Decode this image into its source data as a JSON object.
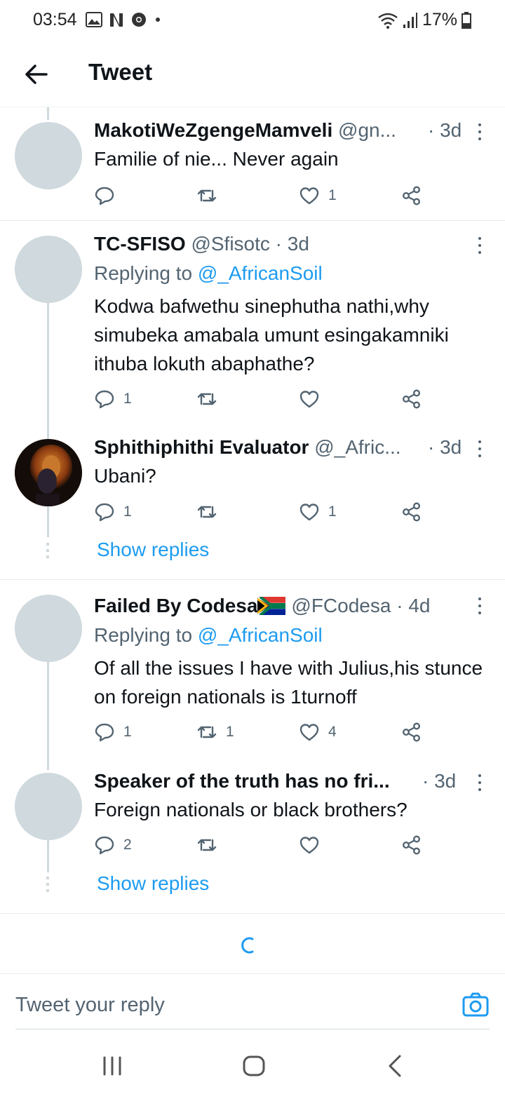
{
  "status_bar": {
    "time": "03:54",
    "battery": "17%"
  },
  "header": {
    "title": "Tweet"
  },
  "tweets": [
    {
      "name": "MakotiWeZgengeMamveli",
      "handle": "@gn...",
      "time": "· 3d",
      "replying_label": "",
      "replying_handle": "",
      "text": "Familie of nie... Never again",
      "replies": "",
      "retweets": "",
      "likes": "1"
    },
    {
      "name": "TC-SFISO",
      "handle": "@Sfisotc · 3d",
      "time": "",
      "replying_label": "Replying to",
      "replying_handle": "@_AfricanSoil",
      "text": "Kodwa bafwethu sinephutha nathi,why simubeka amabala umunt esingakamniki ithuba lokuth abaphathe?",
      "replies": "1",
      "retweets": "",
      "likes": ""
    },
    {
      "name": "Sphithiphithi Evaluator",
      "handle": "@_Afric...",
      "time": "· 3d",
      "replying_label": "",
      "replying_handle": "",
      "text": "Ubani?",
      "replies": "1",
      "retweets": "",
      "likes": "1"
    },
    {
      "name": "Failed By Codesa",
      "handle": "@FCodesa · 4d",
      "time": "",
      "replying_label": "Replying to",
      "replying_handle": "@_AfricanSoil",
      "text": "Of all the issues I have with Julius,his stunce on foreign nationals is 1turnoff",
      "replies": "1",
      "retweets": "1",
      "likes": "4"
    },
    {
      "name": "Speaker of the truth has no fri...",
      "handle": "",
      "time": "· 3d",
      "replying_label": "",
      "replying_handle": "",
      "text": "Foreign nationals or black brothers?",
      "replies": "2",
      "retweets": "",
      "likes": ""
    }
  ],
  "show_replies_label": "Show replies",
  "reply_bar": {
    "placeholder": "Tweet your reply"
  },
  "colors": {
    "accent": "#1d9bf0",
    "avatar_placeholder": "#cfd9de",
    "muted": "#536471"
  },
  "icons": [
    "back-arrow-icon",
    "gallery-icon",
    "netflix-icon",
    "chrome-icon",
    "wifi-icon",
    "signal-icon",
    "battery-icon",
    "reply-icon",
    "retweet-icon",
    "like-icon",
    "share-icon",
    "more-icon",
    "camera-icon",
    "south-africa-flag-icon",
    "loading-spinner-icon"
  ]
}
